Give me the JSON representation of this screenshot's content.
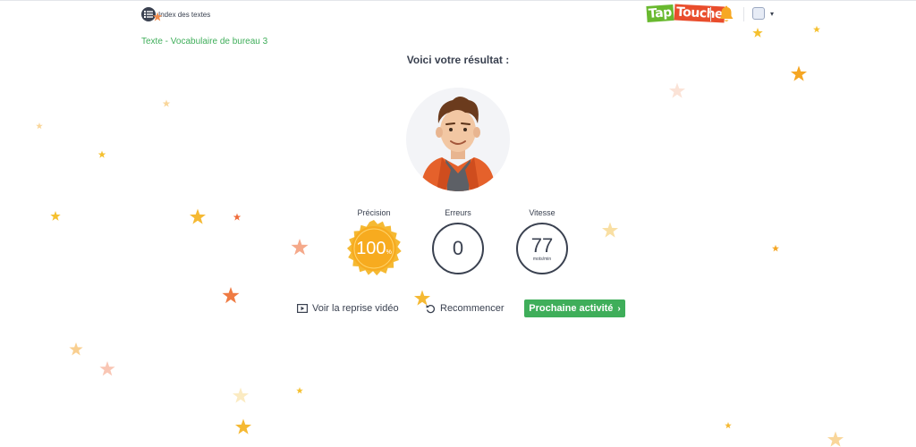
{
  "header": {
    "index_label": "Index des textes",
    "logo_text_1": "Tap",
    "logo_text_2": "Touche"
  },
  "breadcrumb": "Texte - Vocabulaire de bureau 3",
  "result_title": "Voici votre résultat :",
  "stats": {
    "precision": {
      "label": "Précision",
      "value": "100",
      "unit": "%"
    },
    "errors": {
      "label": "Erreurs",
      "value": "0"
    },
    "speed": {
      "label": "Vitesse",
      "value": "77",
      "unit": "mots/min"
    }
  },
  "actions": {
    "replay_label": "Voir la reprise vidéo",
    "restart_label": "Recommencer",
    "next_label": "Prochaine activité"
  },
  "colors": {
    "accent_green": "#3fae5a",
    "text_dark": "#3a4150",
    "star_gold": "#f5b933",
    "star_orange": "#f08a4b",
    "bell_orange": "#f7a823"
  },
  "icons": [
    "list-icon",
    "bell-icon",
    "user-icon",
    "chevron-down-icon",
    "video-icon",
    "restart-icon",
    "chevron-right-icon",
    "star-icon"
  ]
}
